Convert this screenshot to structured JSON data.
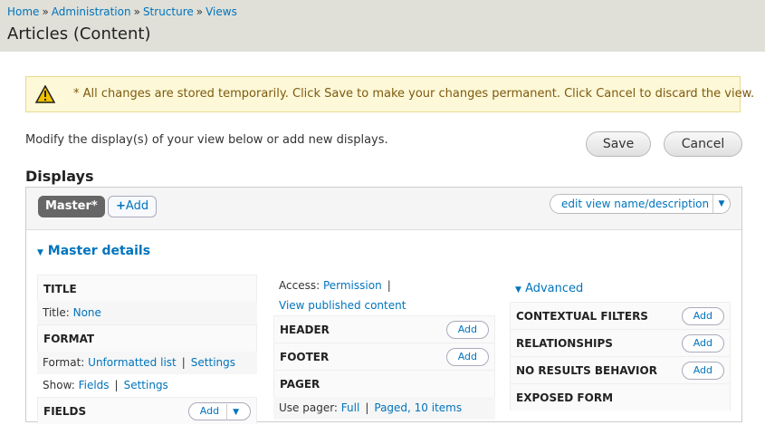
{
  "breadcrumb": [
    "Home",
    "Administration",
    "Structure",
    "Views"
  ],
  "breadcrumb_separator": "»",
  "page_title": "Articles (Content)",
  "warning": {
    "icon": "warning-triangle-icon",
    "message": "* All changes are stored temporarily. Click Save to make your changes permanent. Click Cancel to discard the view."
  },
  "intro_text": "Modify the display(s) of your view below or add new displays.",
  "buttons": {
    "save": "Save",
    "cancel": "Cancel"
  },
  "displays": {
    "heading": "Displays",
    "master_tab": "Master*",
    "add_tab": "Add",
    "add_icon": "plus-icon",
    "edit_view": "edit view name/description",
    "details_toggle": "Master details"
  },
  "col1": {
    "title_head": "TITLE",
    "title_label": "Title:",
    "title_value": "None",
    "format_head": "FORMAT",
    "format_label": "Format:",
    "format_value": "Unformatted list",
    "format_settings": "Settings",
    "show_label": "Show:",
    "show_value": "Fields",
    "show_settings": "Settings",
    "fields_head": "FIELDS",
    "fields_add": "Add"
  },
  "col2": {
    "access_label": "Access:",
    "access_value": "Permission",
    "access_perm": "View published content",
    "header_head": "HEADER",
    "header_add": "Add",
    "footer_head": "FOOTER",
    "footer_add": "Add",
    "pager_head": "PAGER",
    "pager_label": "Use pager:",
    "pager_value1": "Full",
    "pager_value2": "Paged, 10 items"
  },
  "col3": {
    "advanced": "Advanced",
    "contextual_head": "CONTEXTUAL FILTERS",
    "contextual_add": "Add",
    "relationships_head": "RELATIONSHIPS",
    "relationships_add": "Add",
    "noresults_head": "NO RESULTS BEHAVIOR",
    "noresults_add": "Add",
    "exposed_head": "EXPOSED FORM"
  },
  "colors": {
    "link": "#0074bd",
    "header_bg": "#e0e0d8",
    "warning_bg": "#fdf8d7"
  }
}
